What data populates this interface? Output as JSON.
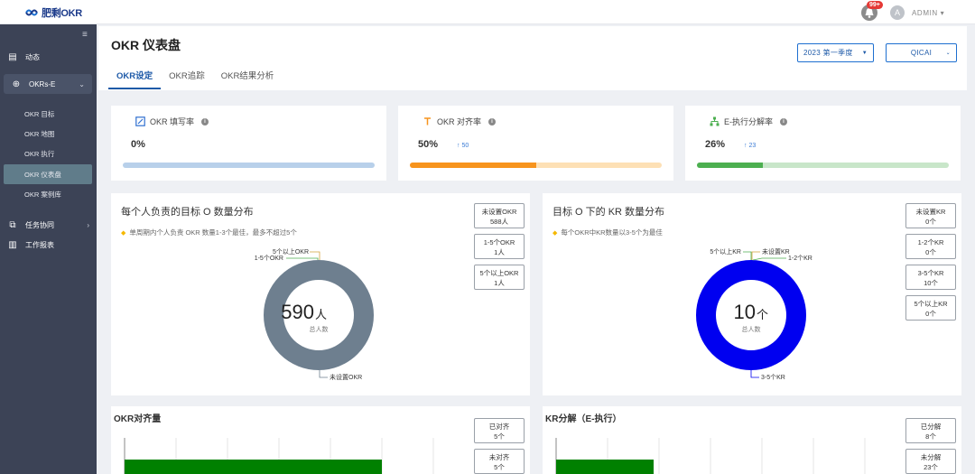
{
  "app": {
    "logo_text": "肥剩OKR",
    "notification_count": "99+",
    "avatar_letter": "A",
    "user": "ADMIN"
  },
  "sidebar": {
    "items": [
      {
        "label": "动态",
        "icon": "feed-icon"
      },
      {
        "label": "OKRs-E",
        "icon": "target-icon"
      },
      {
        "label": "任务协同",
        "icon": "task-icon"
      },
      {
        "label": "工作报表",
        "icon": "report-icon"
      }
    ],
    "sub_items": [
      {
        "label": "OKR 目标"
      },
      {
        "label": "OKR 地图"
      },
      {
        "label": "OKR 执行"
      },
      {
        "label": "OKR 仪表盘"
      },
      {
        "label": "OKR 案例库"
      }
    ]
  },
  "header": {
    "title": "OKR 仪表盘",
    "tabs": [
      {
        "label": "OKR设定"
      },
      {
        "label": "OKR追踪"
      },
      {
        "label": "OKR结果分析"
      }
    ],
    "period_select": "2023  第一季度",
    "org_select": "QICAI"
  },
  "stats": [
    {
      "label": "OKR 填写率",
      "value": "0%",
      "delta": "",
      "fraction": 0.0,
      "accent": "#a9c7e8",
      "track": "#b8d0ea",
      "icon": "edit-icon"
    },
    {
      "label": "OKR 对齐率",
      "value": "50%",
      "delta": "↑ 50",
      "fraction": 0.5,
      "accent": "#f7941d",
      "track": "#fde0b5",
      "icon": "align-icon"
    },
    {
      "label": "E-执行分解率",
      "value": "26%",
      "delta": "↑ 23",
      "fraction": 0.26,
      "accent": "#4caf50",
      "track": "#c8e6c9",
      "icon": "hierarchy-icon"
    }
  ],
  "objectives_panel": {
    "title": "每个人负责的目标 O 数量分布",
    "hint": "单周期内个人负责 OKR 数量1-3个最佳，最多不超过5个",
    "center_value": "590",
    "center_unit": "人",
    "center_caption": "总人数",
    "legend": [
      {
        "label": "未设置OKR",
        "value": "588人"
      },
      {
        "label": "1-5个OKR",
        "value": "1人"
      },
      {
        "label": "5个以上OKR",
        "value": "1人"
      }
    ],
    "slice_labels": {
      "top1": "5个以上OKR",
      "top2": "1-5个OKR",
      "bottom": "未设置OKR"
    },
    "color": "#6e7f8f"
  },
  "kr_panel": {
    "title": "目标 O 下的 KR 数量分布",
    "hint": "每个OKR中KR数量以3-5个为最佳",
    "center_value": "10",
    "center_unit": "个",
    "center_caption": "总人数",
    "legend": [
      {
        "label": "未设置KR",
        "value": "0个"
      },
      {
        "label": "1-2个KR",
        "value": "0个"
      },
      {
        "label": "3-5个KR",
        "value": "10个"
      },
      {
        "label": "5个以上KR",
        "value": "0个"
      }
    ],
    "slice_labels": {
      "top1": "5个以上KR",
      "top2": "未设置KR",
      "right": "1-2个KR",
      "bottom": "3-5个KR"
    },
    "color": "#0000f0"
  },
  "alignment_panel": {
    "title": "OKR对齐量",
    "legend": [
      {
        "label": "已对齐",
        "value": "5个"
      },
      {
        "label": "未对齐",
        "value": "5个"
      }
    ]
  },
  "decompose_panel": {
    "title": "KR分解（E-执行）",
    "legend": [
      {
        "label": "已分解",
        "value": "8个"
      },
      {
        "label": "未分解",
        "value": "23个"
      }
    ]
  }
}
